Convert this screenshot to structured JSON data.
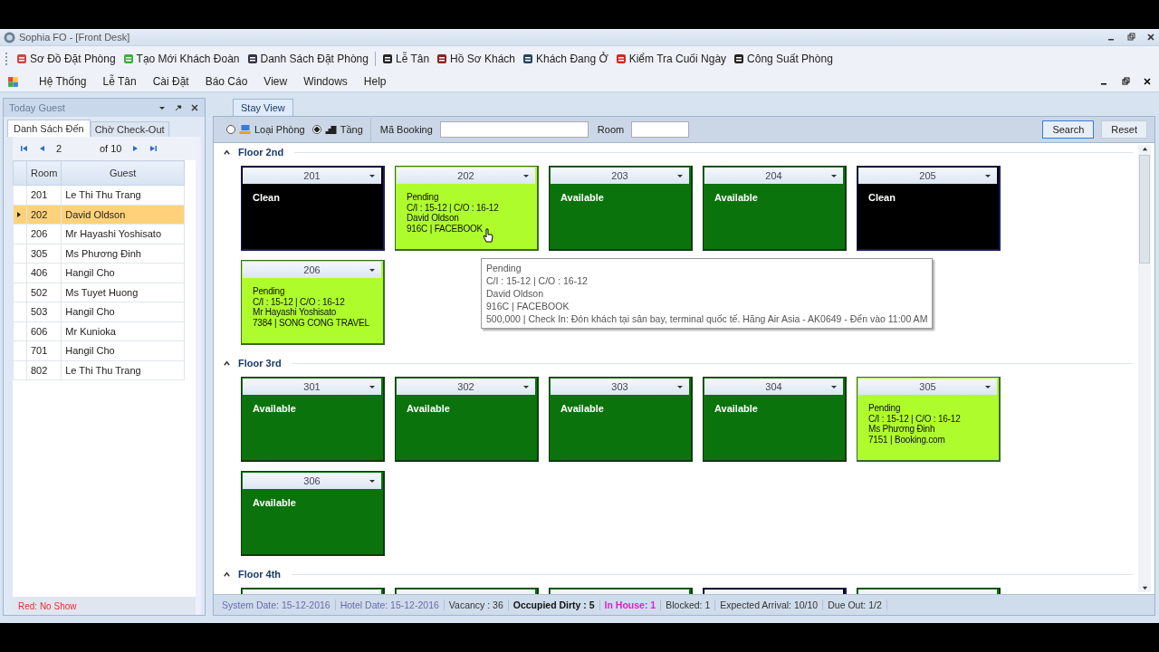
{
  "window": {
    "title": "Sophia FO - [Front Desk]"
  },
  "toolbar": [
    "Sơ Đồ Đặt Phòng",
    "Tạo Mới Khách Đoàn",
    "Danh Sách Đặt Phòng",
    "Lễ Tân",
    "Hồ Sơ Khách",
    "Khách Đang Ở",
    "Kiểm Tra Cuối Ngày",
    "Công Suất Phòng"
  ],
  "menu": [
    "Hệ Thống",
    "Lễ Tân",
    "Cài Đặt",
    "Báo Cáo",
    "View",
    "Windows",
    "Help"
  ],
  "left_panel": {
    "title": "Today Guest",
    "tabs": [
      {
        "label": "Danh Sách Đến",
        "selected": true
      },
      {
        "label": "Chờ Check-Out",
        "selected": false
      }
    ],
    "pager": {
      "page": "2",
      "of": "of 10"
    },
    "columns": [
      "Room",
      "Guest"
    ],
    "rows": [
      {
        "room": "201",
        "guest": "Le Thi Thu Trang",
        "selected": false
      },
      {
        "room": "202",
        "guest": "David Oldson",
        "selected": true
      },
      {
        "room": "206",
        "guest": "Mr Hayashi Yoshisato",
        "selected": false
      },
      {
        "room": "305",
        "guest": "Ms Phương Đinh",
        "selected": false
      },
      {
        "room": "406",
        "guest": "Hangil Cho",
        "selected": false
      },
      {
        "room": "502",
        "guest": "Ms Tuyet Huong",
        "selected": false
      },
      {
        "room": "503",
        "guest": "Hangil Cho",
        "selected": false
      },
      {
        "room": "606",
        "guest": "Mr Kunioka",
        "selected": false
      },
      {
        "room": "701",
        "guest": "Hangil Cho",
        "selected": false
      },
      {
        "room": "802",
        "guest": "Le Thi Thu Trang",
        "selected": false
      }
    ],
    "legend": "Red: No Show"
  },
  "main": {
    "tab": {
      "label": "Stay View",
      "selected": true
    },
    "view_options": [
      {
        "label": "Loại Phòng",
        "selected": false
      },
      {
        "label": "Tầng",
        "selected": true
      }
    ],
    "booking_label": "Mã Booking",
    "room_label": "Room",
    "search_button": "Search",
    "reset_button": "Reset",
    "floors": [
      {
        "name": "Floor 2nd",
        "expanded": true,
        "rooms": [
          {
            "number": "201",
            "kind": "clean",
            "lines": [
              "Clean"
            ]
          },
          {
            "number": "202",
            "kind": "pending",
            "lines": [
              "Pending",
              "C/I : 15-12 | C/O : 16-12",
              "David Oldson",
              "916C | FACEBOOK"
            ]
          },
          {
            "number": "203",
            "kind": "available",
            "lines": [
              "Available"
            ]
          },
          {
            "number": "204",
            "kind": "available",
            "lines": [
              "Available"
            ]
          },
          {
            "number": "205",
            "kind": "clean",
            "lines": [
              "Clean"
            ]
          },
          {
            "number": "206",
            "kind": "pending",
            "lines": [
              "Pending",
              "C/I : 15-12 | C/O : 16-12",
              "Mr Hayashi Yoshisato",
              "7384 | SONG CONG TRAVEL"
            ]
          }
        ]
      },
      {
        "name": "Floor 3rd",
        "expanded": true,
        "rooms": [
          {
            "number": "301",
            "kind": "available",
            "lines": [
              "Available"
            ]
          },
          {
            "number": "302",
            "kind": "available",
            "lines": [
              "Available"
            ]
          },
          {
            "number": "303",
            "kind": "available",
            "lines": [
              "Available"
            ]
          },
          {
            "number": "304",
            "kind": "available",
            "lines": [
              "Available"
            ]
          },
          {
            "number": "305",
            "kind": "pending",
            "lines": [
              "Pending",
              "C/I : 15-12 | C/O : 16-12",
              "Ms Phương Đinh",
              "7151 | Booking.com"
            ]
          },
          {
            "number": "306",
            "kind": "available",
            "lines": [
              "Available"
            ]
          }
        ]
      },
      {
        "name": "Floor 4th",
        "expanded": true,
        "rooms": [
          {
            "kind": "available"
          },
          {
            "kind": "available"
          },
          {
            "kind": "available"
          },
          {
            "kind": "clean"
          },
          {
            "kind": "available"
          }
        ]
      }
    ],
    "tooltip": [
      "Pending",
      "C/I : 15-12 | C/O : 16-12",
      "David Oldson",
      "916C | FACEBOOK",
      "500,000 | Check In: Đón khách tại sân bay, terminal quốc tế. Hãng Air Asia - AK0649 - Đến vào 11:00 AM"
    ]
  },
  "status_bar": [
    {
      "text": "System Date: 15-12-2016",
      "kind": "muted"
    },
    {
      "text": "Hotel Date: 15-12-2016",
      "kind": "muted"
    },
    {
      "text": "Vacancy : 36",
      "kind": "plain"
    },
    {
      "text": "Occupied Dirty : 5",
      "kind": "bold"
    },
    {
      "text": "In House: 1",
      "kind": "highlight"
    },
    {
      "text": "Blocked: 1",
      "kind": "plain"
    },
    {
      "text": "Expected Arrival: 10/10",
      "kind": "plain"
    },
    {
      "text": "Due Out: 1/2",
      "kind": "plain"
    }
  ]
}
